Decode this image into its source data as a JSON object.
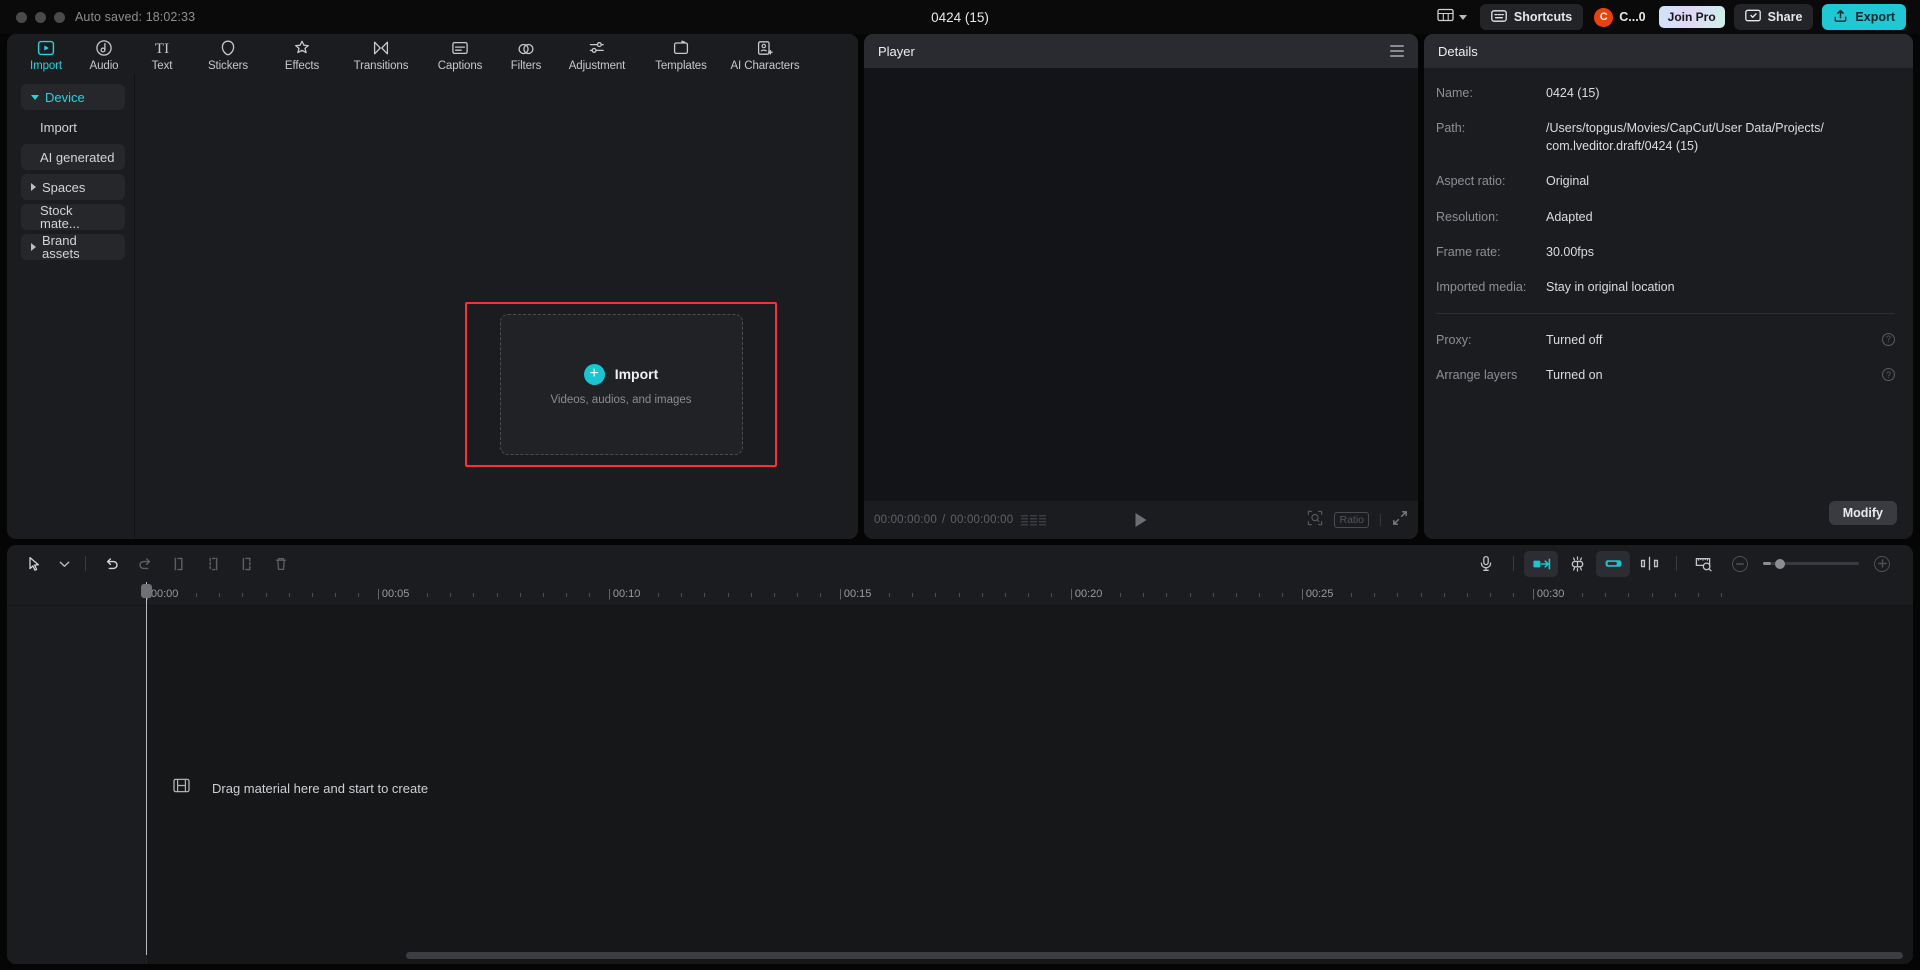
{
  "titlebar": {
    "autosave": "Auto saved: 18:02:33",
    "project_title": "0424 (15)",
    "layout_icon": "panel-layout-icon",
    "shortcuts_label": "Shortcuts",
    "account_label": "C...0",
    "account_initial": "C",
    "join_pro_label": "Join Pro",
    "share_label": "Share",
    "export_label": "Export",
    "accent_export": "#1ec8d4",
    "accent_avatar": "#f0400a"
  },
  "tabs": [
    {
      "label": "Import",
      "icon": "import-icon",
      "active": true
    },
    {
      "label": "Audio",
      "icon": "audio-icon",
      "active": false
    },
    {
      "label": "Text",
      "icon": "text-icon",
      "active": false
    },
    {
      "label": "Stickers",
      "icon": "stickers-icon",
      "active": false
    },
    {
      "label": "Effects",
      "icon": "effects-icon",
      "active": false
    },
    {
      "label": "Transitions",
      "icon": "transitions-icon",
      "active": false
    },
    {
      "label": "Captions",
      "icon": "captions-icon",
      "active": false
    },
    {
      "label": "Filters",
      "icon": "filters-icon",
      "active": false
    },
    {
      "label": "Adjustment",
      "icon": "adjustment-icon",
      "active": false
    },
    {
      "label": "Templates",
      "icon": "templates-icon",
      "active": false
    },
    {
      "label": "AI Characters",
      "icon": "ai-characters-icon",
      "active": false
    }
  ],
  "sidebar": {
    "items": [
      {
        "label": "Device",
        "selected": true,
        "expandable": true,
        "expanded": true,
        "filled": true
      },
      {
        "label": "Import",
        "selected": false,
        "expandable": false,
        "expanded": false,
        "filled": false
      },
      {
        "label": "AI generated",
        "selected": false,
        "expandable": false,
        "expanded": false,
        "filled": true
      },
      {
        "label": "Spaces",
        "selected": false,
        "expandable": true,
        "expanded": false,
        "filled": true
      },
      {
        "label": "Stock mate...",
        "selected": false,
        "expandable": false,
        "expanded": false,
        "filled": true
      },
      {
        "label": "Brand assets",
        "selected": false,
        "expandable": true,
        "expanded": false,
        "filled": true
      }
    ]
  },
  "dropzone": {
    "title": "Import",
    "subtitle": "Videos, audios, and images",
    "plus_icon": "plus-icon",
    "highlight_color": "#ff2d36"
  },
  "player": {
    "title": "Player",
    "menu_icon": "hamburger-icon",
    "current_time": "00:00:00:00",
    "total_time": "00:00:00:00",
    "time_separator": "/",
    "play_icon": "play-icon",
    "magnifier_icon": "magnifier-icon",
    "ratio_label": "Ratio",
    "fullscreen_icon": "fullscreen-icon"
  },
  "details": {
    "title": "Details",
    "rows": [
      {
        "key": "Name:",
        "value": "0424 (15)",
        "help": false
      },
      {
        "key": "Path:",
        "value": "/Users/topgus/Movies/CapCut/User Data/Projects/\ncom.lveditor.draft/0424 (15)",
        "help": false
      },
      {
        "key": "Aspect ratio:",
        "value": "Original",
        "help": false
      },
      {
        "key": "Resolution:",
        "value": "Adapted",
        "help": false
      },
      {
        "key": "Frame rate:",
        "value": "30.00fps",
        "help": false
      },
      {
        "key": "Imported media:",
        "value": "Stay in original location",
        "help": false
      }
    ],
    "rows_after_separator": [
      {
        "key": "Proxy:",
        "value": "Turned off",
        "help": true
      },
      {
        "key": "Arrange layers",
        "value": "Turned on",
        "help": true
      }
    ],
    "modify_label": "Modify"
  },
  "timeline": {
    "tools_left": [
      {
        "name": "select-tool",
        "icon": "cursor-icon"
      },
      {
        "name": "select-tool-dropdown",
        "icon": "chevron-down-icon"
      },
      {
        "name": "undo-button",
        "icon": "undo-icon"
      },
      {
        "name": "redo-button",
        "icon": "redo-icon"
      },
      {
        "name": "trim-left-button",
        "icon": "trim-left-icon"
      },
      {
        "name": "trim-right-button",
        "icon": "trim-right-icon"
      },
      {
        "name": "split-button",
        "icon": "split-icon"
      },
      {
        "name": "delete-button",
        "icon": "trash-icon"
      }
    ],
    "tools_right": [
      {
        "name": "record-voiceover-button",
        "icon": "microphone-icon",
        "active": false
      },
      {
        "name": "auto-snap-button",
        "icon": "snap-icon",
        "active": true
      },
      {
        "name": "magnet-button",
        "icon": "magnet-icon",
        "active": false
      },
      {
        "name": "link-button",
        "icon": "link-icon",
        "active": true
      },
      {
        "name": "mirror-button",
        "icon": "mirror-icon",
        "active": false
      },
      {
        "name": "render-preview-button",
        "icon": "render-preview-icon",
        "active": false
      }
    ],
    "zoom_out_icon": "zoom-out-icon",
    "zoom_in_icon": "zoom-in-icon",
    "ruler_labels": [
      "00:00",
      "00:05",
      "00:10",
      "00:15",
      "00:20",
      "00:25",
      "00:30"
    ],
    "ruler_label_positions": [
      0,
      231,
      462,
      693,
      924,
      1155,
      1386
    ],
    "placeholder_text": "Drag material here and start to create",
    "placeholder_icon": "film-strip-icon"
  }
}
